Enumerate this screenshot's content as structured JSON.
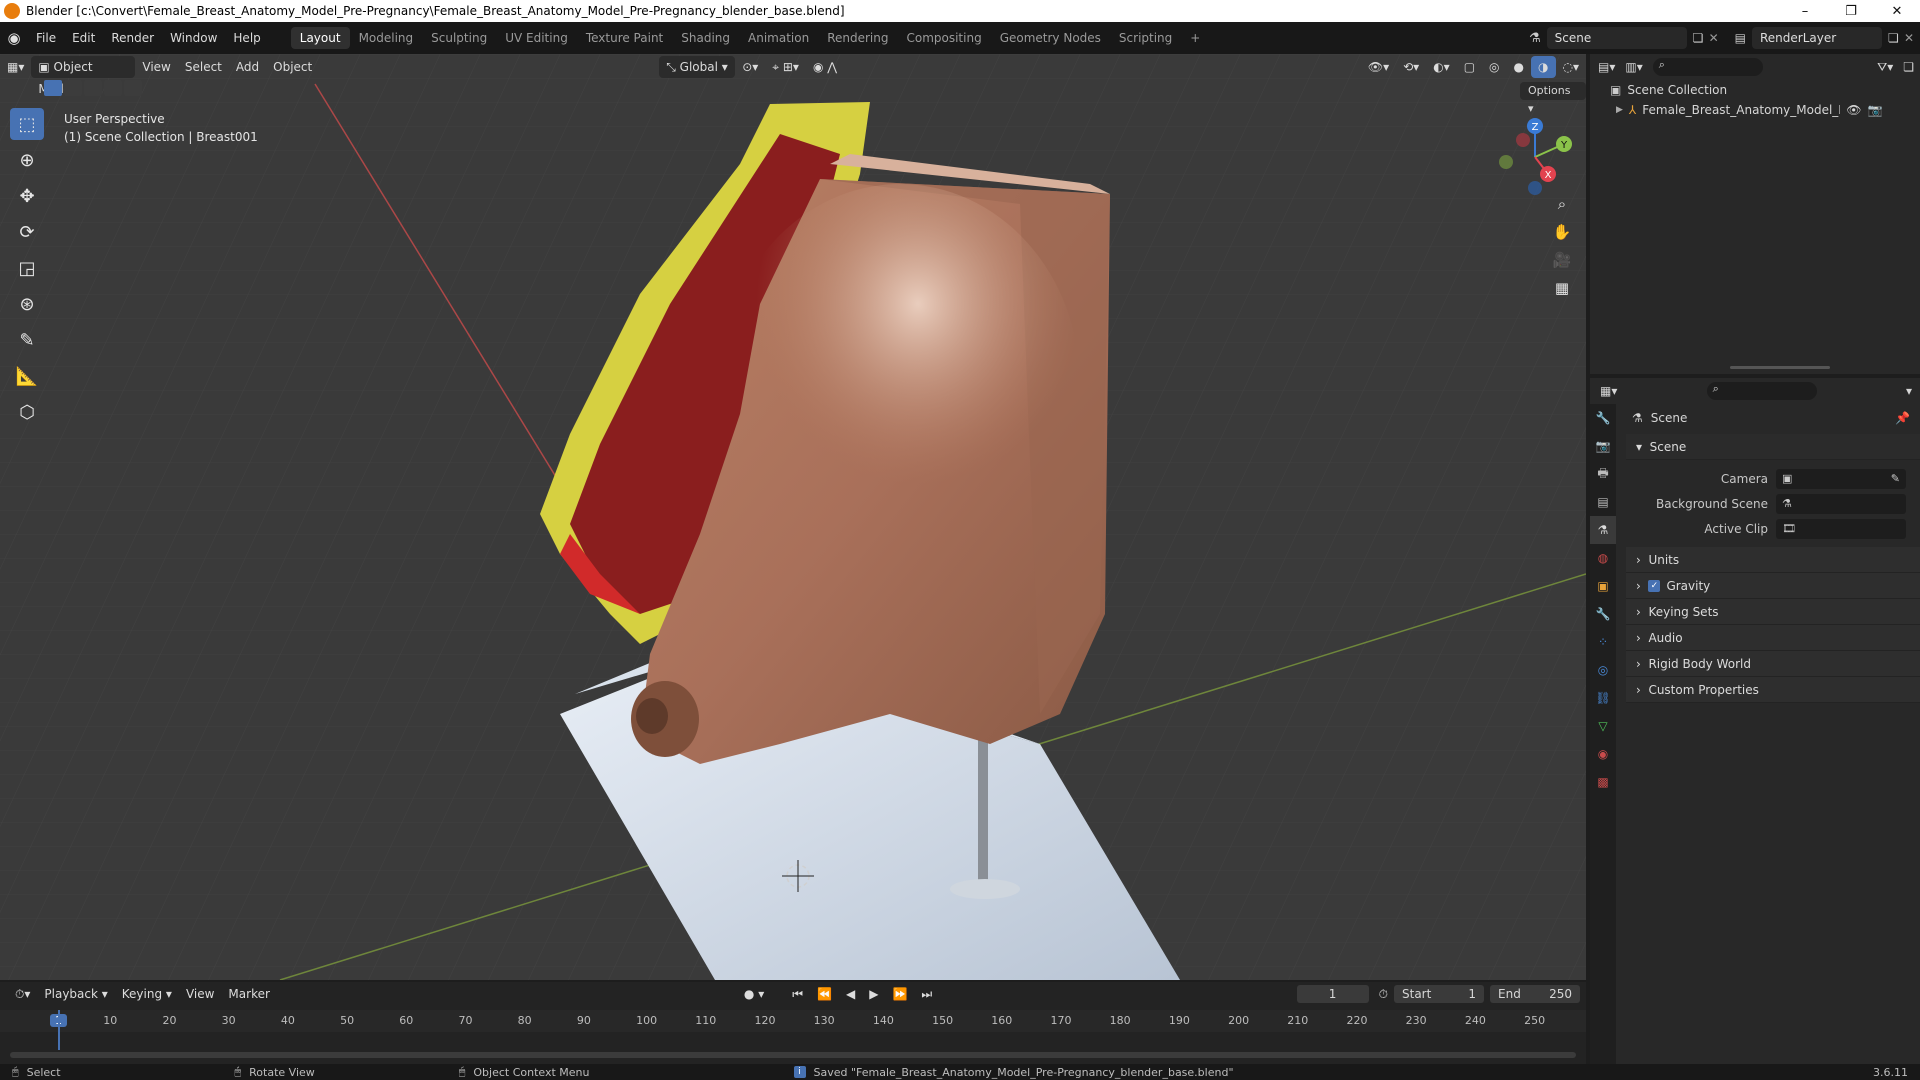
{
  "window": {
    "title": "Blender [c:\\Convert\\Female_Breast_Anatomy_Model_Pre-Pregnancy\\Female_Breast_Anatomy_Model_Pre-Pregnancy_blender_base.blend]",
    "minimize": "–",
    "maximize": "❐",
    "close": "✕"
  },
  "menu": [
    "File",
    "Edit",
    "Render",
    "Window",
    "Help"
  ],
  "workspaces": [
    "Layout",
    "Modeling",
    "Sculpting",
    "UV Editing",
    "Texture Paint",
    "Shading",
    "Animation",
    "Rendering",
    "Compositing",
    "Geometry Nodes",
    "Scripting"
  ],
  "active_workspace": "Layout",
  "add_workspace": "+",
  "scene_selector": {
    "value": "Scene"
  },
  "view_layer_selector": {
    "value": "RenderLayer"
  },
  "viewport_header": {
    "mode": "Object Mode",
    "menus": [
      "View",
      "Select",
      "Add",
      "Object"
    ],
    "orientation": "Global",
    "options": "Options"
  },
  "viewport": {
    "perspective": "User Perspective",
    "collection_info": "(1) Scene Collection | Breast001"
  },
  "gizmo_axes": {
    "x": "X",
    "y": "Y",
    "z": "Z"
  },
  "outliner": {
    "root": "Scene Collection",
    "items": [
      {
        "label": "Female_Breast_Anatomy_Model_Pre_Pr"
      }
    ]
  },
  "properties": {
    "context": "Scene",
    "panel": "Scene",
    "fields": [
      {
        "label": "Camera",
        "value": ""
      },
      {
        "label": "Background Scene",
        "value": ""
      },
      {
        "label": "Active Clip",
        "value": ""
      }
    ],
    "sections": [
      "Units",
      "Gravity",
      "Keying Sets",
      "Audio",
      "Rigid Body World",
      "Custom Properties"
    ],
    "gravity_checked": true
  },
  "timeline": {
    "menus": [
      "Playback",
      "Keying",
      "View",
      "Marker"
    ],
    "current_frame": "1",
    "start_label": "Start",
    "start": "1",
    "end_label": "End",
    "end": "250",
    "ruler": [
      "1",
      "10",
      "20",
      "30",
      "40",
      "50",
      "60",
      "70",
      "80",
      "90",
      "100",
      "110",
      "120",
      "130",
      "140",
      "150",
      "160",
      "170",
      "180",
      "190",
      "200",
      "210",
      "220",
      "230",
      "240",
      "250"
    ]
  },
  "statusbar": {
    "select": "Select",
    "rotate": "Rotate View",
    "context_menu": "Object Context Menu",
    "message": "Saved \"Female_Breast_Anatomy_Model_Pre-Pregnancy_blender_base.blend\"",
    "version": "3.6.11"
  },
  "colors": {
    "accent": "#4772b3",
    "current_frame": "#4772b3",
    "x_axis": "#e2434f",
    "y_axis": "#8bc34a",
    "z_axis": "#3a7bd5"
  }
}
